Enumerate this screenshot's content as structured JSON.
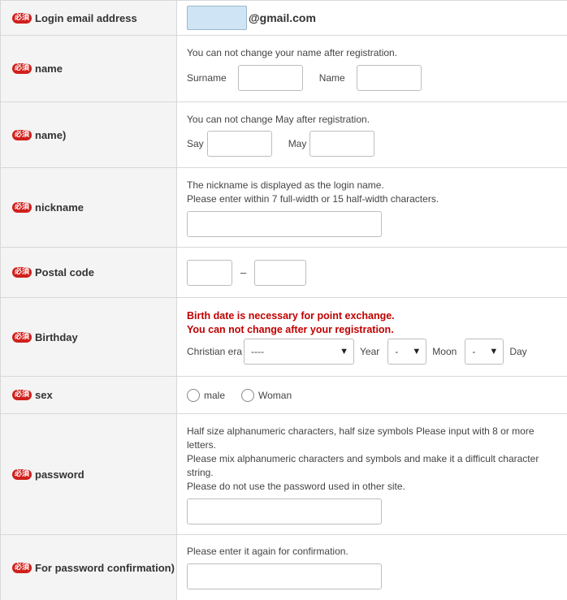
{
  "rows": {
    "email": {
      "required": "必須",
      "label": "Login email address",
      "suffix": "@gmail.com"
    },
    "name": {
      "required": "必須",
      "label": "name",
      "note": "You can not change your name after registration.",
      "surname_label": "Surname",
      "name_label": "Name"
    },
    "kana": {
      "required": "必須",
      "label": "name)",
      "note": "You can not change May after registration.",
      "say_label": "Say",
      "may_label": "May"
    },
    "nickname": {
      "required": "必須",
      "label": "nickname",
      "note1": "The nickname is displayed as the login name.",
      "note2": "Please enter within 7 full-width or 15 half-width characters."
    },
    "postal": {
      "required": "必須",
      "label": "Postal code",
      "dash": "–"
    },
    "birthday": {
      "required": "必須",
      "label": "Birthday",
      "warn1": "Birth date is necessary for point exchange.",
      "warn2": "You can not change after your registration.",
      "era_label": "Christian era",
      "era_value": "----",
      "year_label": "Year",
      "month_value": "-",
      "month_label": "Moon",
      "day_value": "-",
      "day_label": "Day"
    },
    "sex": {
      "required": "必須",
      "label": "sex",
      "male": "male",
      "woman": "Woman"
    },
    "password": {
      "required": "必須",
      "label": "password",
      "note1": "Half size alphanumeric characters, half size symbols Please input with 8 or more letters.",
      "note2": "Please mix alphanumeric characters and symbols and make it a difficult character string.",
      "note3": "Please do not use the password used in other site."
    },
    "confirm": {
      "required": "必須",
      "label": "For password confirmation)",
      "note": "Please enter it again for confirmation."
    }
  },
  "icons": {
    "dropdown": "caret-down-icon",
    "radio": "radio-circle-icon"
  },
  "colors": {
    "required_badge": "#d0201c",
    "warning_text": "#c00000",
    "email_highlight": "#cfe4f4"
  }
}
